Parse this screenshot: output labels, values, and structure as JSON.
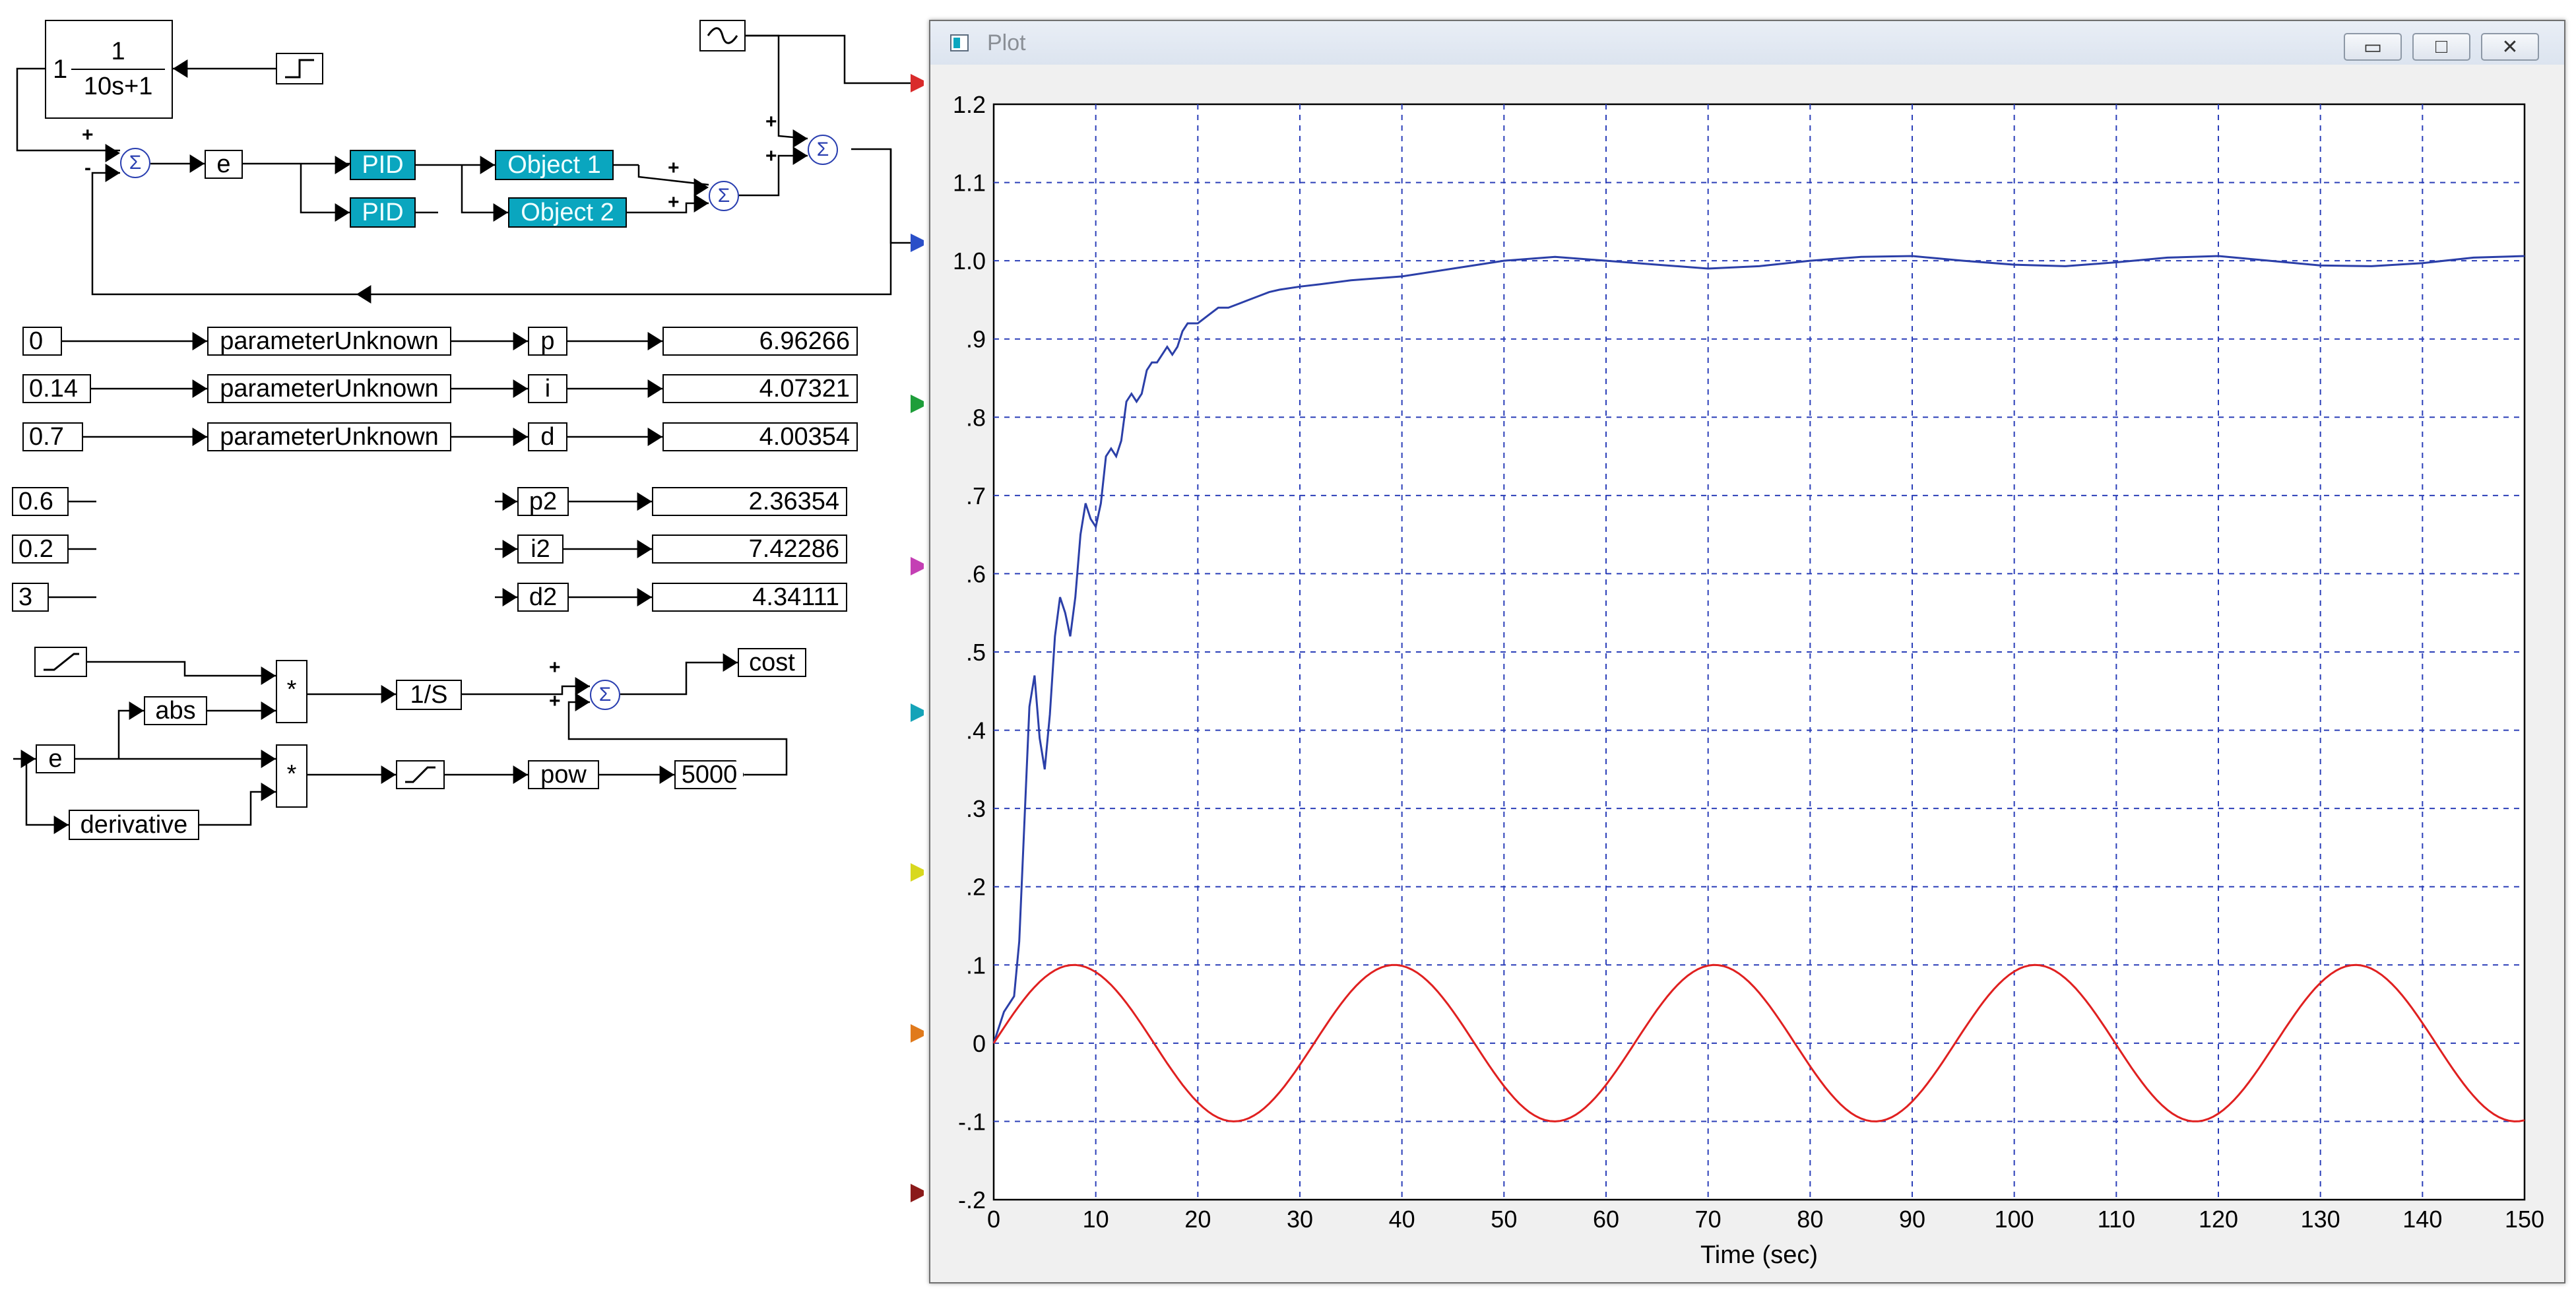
{
  "diagram": {
    "transfer_fn": {
      "gain": "1",
      "numerator": "1",
      "denominator": "10s+1"
    },
    "signal_e": "e",
    "pid1": "PID",
    "pid2": "PID",
    "object1": "Object 1",
    "object2": "Object 2",
    "param_rows": [
      {
        "input": "0",
        "block": "parameterUnknown",
        "name": "p",
        "value": "6.96266"
      },
      {
        "input": "0.14",
        "block": "parameterUnknown",
        "name": "i",
        "value": "4.07321"
      },
      {
        "input": "0.7",
        "block": "parameterUnknown",
        "name": "d",
        "value": "4.00354"
      }
    ],
    "constants2": [
      "0.6",
      "0.2",
      "3"
    ],
    "param_rows2": [
      {
        "name": "p2",
        "value": "2.36354"
      },
      {
        "name": "i2",
        "value": "7.42286"
      },
      {
        "name": "d2",
        "value": "4.34111"
      }
    ],
    "cost": {
      "mult1": "*",
      "mult2": "*",
      "abs": "abs",
      "e": "e",
      "derivative": "derivative",
      "integrator": "1/S",
      "pow": "pow",
      "const5000": "5000",
      "cost": "cost"
    },
    "sum_symbol": "Σ",
    "port_colors": [
      "#d92b2b",
      "#2a4fc8",
      "#1e9e3a",
      "#c43fb4",
      "#15a3b8",
      "#d8d81e",
      "#e07a1c",
      "#8b1a1a"
    ]
  },
  "plot_window": {
    "title": "Plot",
    "buttons": {
      "minimize": "▭",
      "maximize": "□",
      "close": "✕"
    }
  },
  "chart_data": {
    "type": "line",
    "xlabel": "Time (sec)",
    "ylabel": "",
    "xlim": [
      0,
      150
    ],
    "ylim": [
      -0.2,
      1.2
    ],
    "xticks": [
      "0",
      "10",
      "20",
      "30",
      "40",
      "50",
      "60",
      "70",
      "80",
      "90",
      "100",
      "110",
      "120",
      "130",
      "140",
      "150"
    ],
    "yticks": [
      "1.2",
      "1.1",
      "1.0",
      ".9",
      ".8",
      ".7",
      ".6",
      ".5",
      ".4",
      ".3",
      ".2",
      ".1",
      "0",
      "-.1",
      "-.2"
    ],
    "grid": true,
    "series": [
      {
        "color": "#2b3fa8",
        "x": [
          0,
          1,
          2,
          2.5,
          3,
          3.5,
          4,
          4.5,
          5,
          5.5,
          6,
          6.5,
          7,
          7.5,
          8,
          8.5,
          9,
          9.5,
          10,
          10.5,
          11,
          11.5,
          12,
          12.5,
          13,
          13.5,
          14,
          14.5,
          15,
          15.5,
          16,
          16.5,
          17,
          17.5,
          18,
          18.5,
          19,
          19.5,
          20,
          21,
          22,
          23,
          24,
          25,
          26,
          27,
          28,
          30,
          32,
          35,
          40,
          45,
          50,
          55,
          60,
          65,
          70,
          75,
          80,
          85,
          90,
          95,
          100,
          105,
          110,
          115,
          120,
          125,
          130,
          135,
          140,
          145,
          150
        ],
        "y": [
          0,
          0.04,
          0.06,
          0.13,
          0.28,
          0.43,
          0.47,
          0.39,
          0.35,
          0.42,
          0.52,
          0.57,
          0.55,
          0.52,
          0.57,
          0.65,
          0.69,
          0.67,
          0.66,
          0.69,
          0.75,
          0.76,
          0.75,
          0.77,
          0.82,
          0.83,
          0.82,
          0.83,
          0.86,
          0.87,
          0.87,
          0.88,
          0.89,
          0.88,
          0.89,
          0.91,
          0.92,
          0.92,
          0.92,
          0.93,
          0.94,
          0.94,
          0.945,
          0.95,
          0.955,
          0.96,
          0.963,
          0.967,
          0.97,
          0.975,
          0.98,
          0.99,
          1.0,
          1.005,
          1.0,
          0.995,
          0.99,
          0.993,
          1.0,
          1.005,
          1.006,
          1.0,
          0.995,
          0.993,
          0.998,
          1.004,
          1.006,
          1.0,
          0.994,
          0.993,
          0.997,
          1.004,
          1.006
        ]
      },
      {
        "color": "#e02020",
        "function": "0.1*sin(2*pi*t/31.4)",
        "amplitude": 0.1,
        "period": 31.4
      }
    ]
  }
}
